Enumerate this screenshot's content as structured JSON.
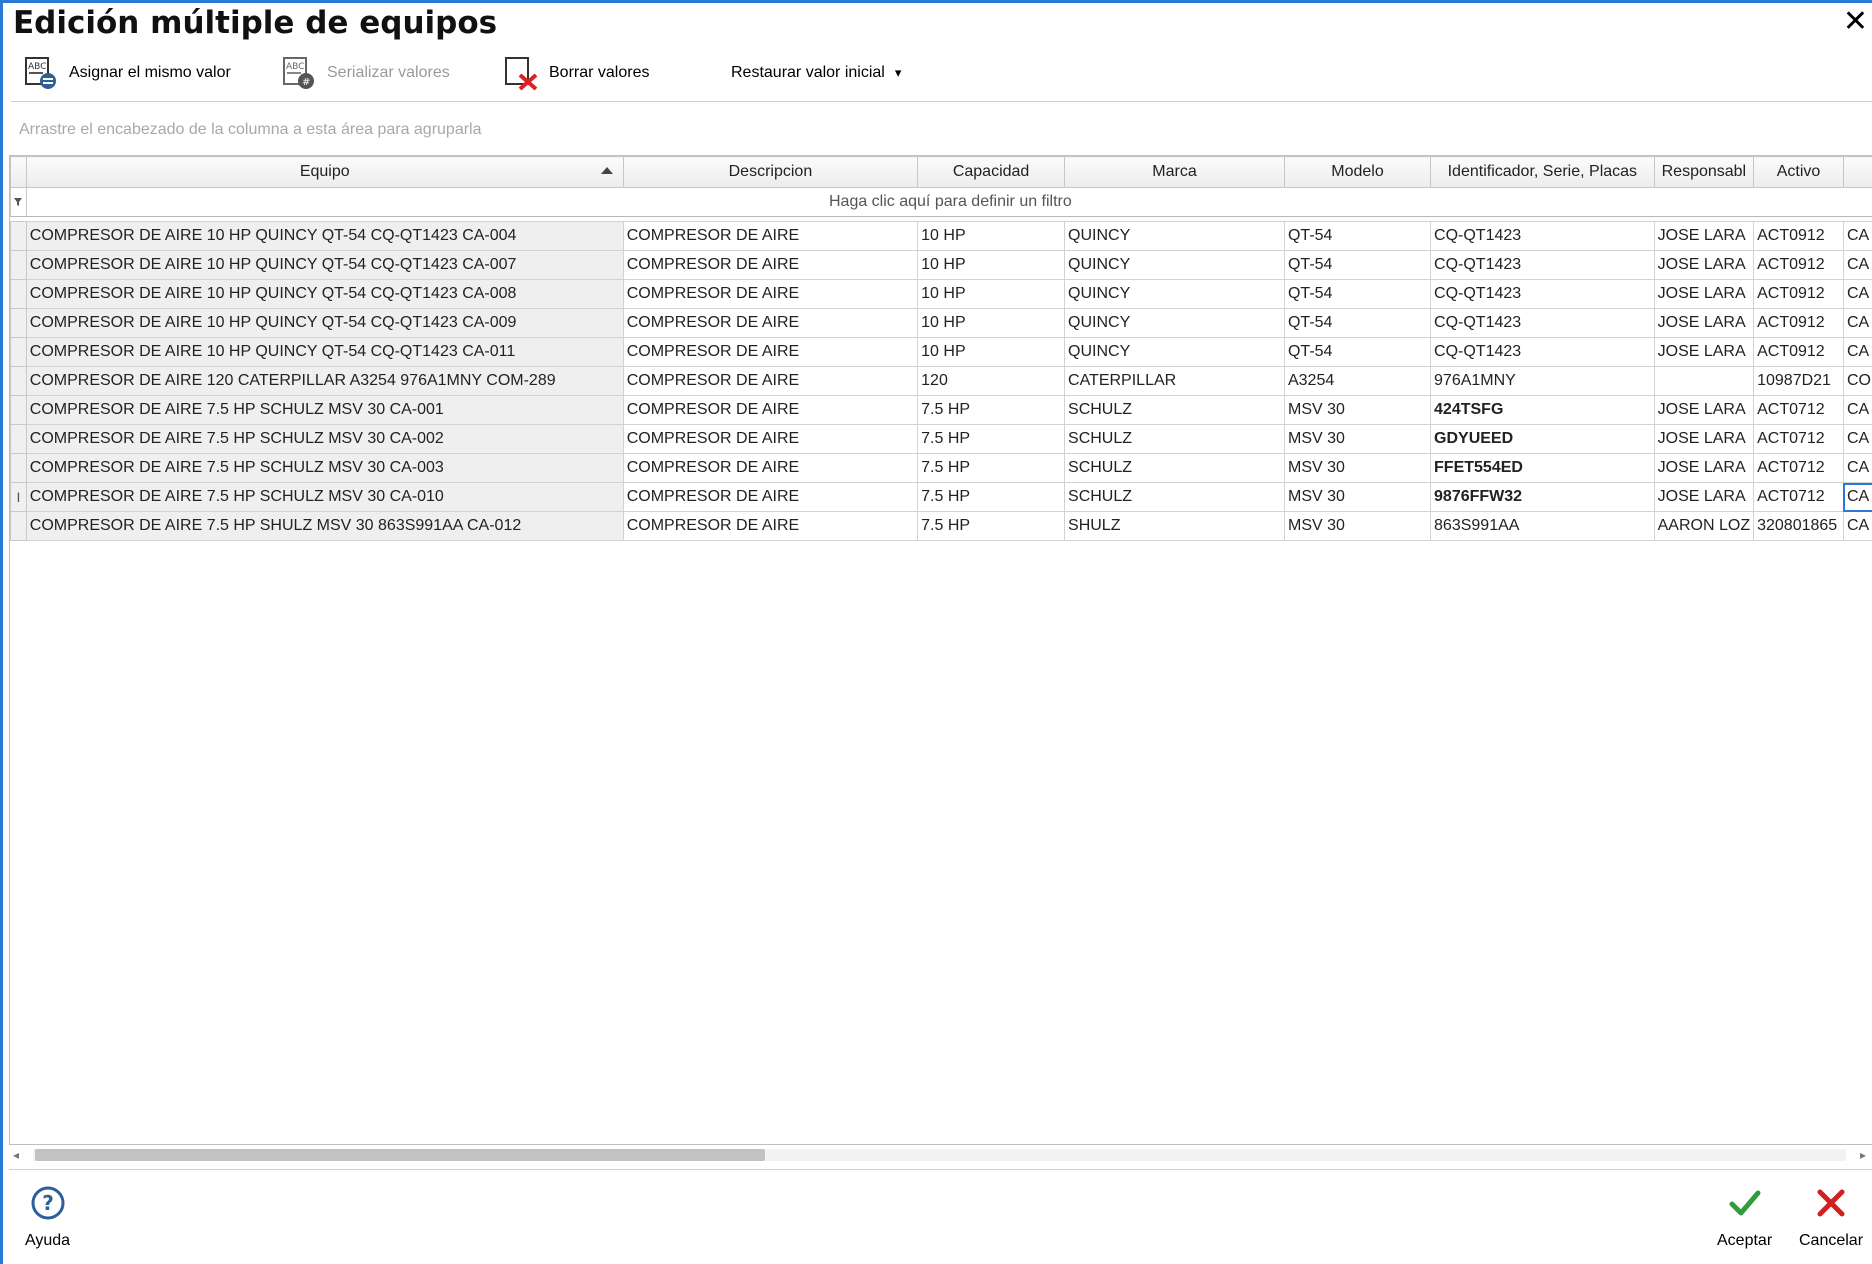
{
  "window": {
    "title": "Edición múltiple de equipos",
    "close_glyph": "✕"
  },
  "toolbar": {
    "assign_same": "Asignar el mismo valor",
    "serialize": "Serializar valores",
    "clear": "Borrar valores",
    "restore": "Restaurar valor inicial",
    "restore_caret": "▾"
  },
  "group_area": {
    "hint": "Arrastre el encabezado de la columna a esta área para agruparla"
  },
  "grid": {
    "columns": [
      "Equipo",
      "Descripcion",
      "Capacidad",
      "Marca",
      "Modelo",
      "Identificador, Serie, Placas",
      "Responsabl",
      "Activo",
      ""
    ],
    "filter_hint": "Haga clic aquí para definir un filtro",
    "row_indicator_glyph": "I",
    "rows": [
      [
        "COMPRESOR DE AIRE 10 HP QUINCY QT-54 CQ-QT1423 CA-004",
        "COMPRESOR DE AIRE",
        "10 HP",
        "QUINCY",
        "QT-54",
        "CQ-QT1423",
        "JOSE LARA",
        "ACT0912",
        "CA"
      ],
      [
        "COMPRESOR DE AIRE 10 HP QUINCY QT-54 CQ-QT1423 CA-007",
        "COMPRESOR DE AIRE",
        "10 HP",
        "QUINCY",
        "QT-54",
        "CQ-QT1423",
        "JOSE LARA",
        "ACT0912",
        "CA"
      ],
      [
        "COMPRESOR DE AIRE 10 HP QUINCY QT-54 CQ-QT1423 CA-008",
        "COMPRESOR DE AIRE",
        "10 HP",
        "QUINCY",
        "QT-54",
        "CQ-QT1423",
        "JOSE LARA",
        "ACT0912",
        "CA"
      ],
      [
        "COMPRESOR DE AIRE 10 HP QUINCY QT-54 CQ-QT1423 CA-009",
        "COMPRESOR DE AIRE",
        "10 HP",
        "QUINCY",
        "QT-54",
        "CQ-QT1423",
        "JOSE LARA",
        "ACT0912",
        "CA"
      ],
      [
        "COMPRESOR DE AIRE 10 HP QUINCY QT-54 CQ-QT1423 CA-011",
        "COMPRESOR DE AIRE",
        "10 HP",
        "QUINCY",
        "QT-54",
        "CQ-QT1423",
        "JOSE LARA",
        "ACT0912",
        "CA"
      ],
      [
        "COMPRESOR DE AIRE 120 CATERPILLAR A3254 976A1MNY COM-289",
        "COMPRESOR DE AIRE",
        "120",
        "CATERPILLAR",
        "A3254",
        "976A1MNY",
        "",
        "10987D21",
        "CO"
      ],
      [
        "COMPRESOR DE AIRE 7.5 HP SCHULZ MSV 30 CA-001",
        "COMPRESOR DE AIRE",
        "7.5 HP",
        "SCHULZ",
        "MSV 30",
        "424TSFG",
        "JOSE LARA",
        "ACT0712",
        "CA"
      ],
      [
        "COMPRESOR DE AIRE 7.5 HP SCHULZ MSV 30 CA-002",
        "COMPRESOR DE AIRE",
        "7.5 HP",
        "SCHULZ",
        "MSV 30",
        "GDYUEED",
        "JOSE LARA",
        "ACT0712",
        "CA"
      ],
      [
        "COMPRESOR DE AIRE 7.5 HP SCHULZ MSV 30 CA-003",
        "COMPRESOR DE AIRE",
        "7.5 HP",
        "SCHULZ",
        "MSV 30",
        "FFET554ED",
        "JOSE LARA",
        "ACT0712",
        "CA"
      ],
      [
        "COMPRESOR DE AIRE 7.5 HP SCHULZ MSV 30 CA-010",
        "COMPRESOR DE AIRE",
        "7.5 HP",
        "SCHULZ",
        "MSV 30",
        "9876FFW32",
        "JOSE LARA",
        "ACT0712",
        "CA"
      ],
      [
        "COMPRESOR DE AIRE 7.5 HP SHULZ MSV 30 863S991AA CA-012",
        "COMPRESOR DE AIRE",
        "7.5 HP",
        "SHULZ",
        "MSV 30",
        "863S991AA",
        "AARON LOZ",
        "320801865",
        "CA"
      ]
    ]
  },
  "footer": {
    "help": "Ayuda",
    "help_glyph": "?",
    "accept": "Aceptar",
    "cancel": "Cancelar"
  },
  "colors": {
    "accent": "#2b79d7",
    "accept_green": "#2e9e3a",
    "cancel_red": "#d21f1f"
  }
}
